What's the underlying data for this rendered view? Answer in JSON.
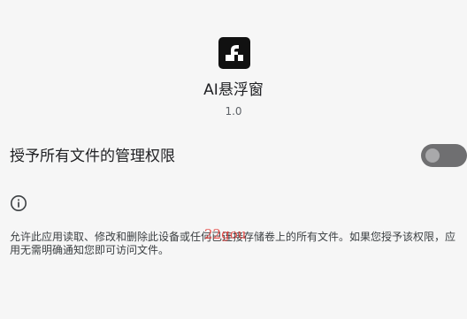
{
  "app": {
    "name": "AI悬浮窗",
    "version": "1.0",
    "icon": "app-logo-icon"
  },
  "permission": {
    "label": "授予所有文件的管理权限",
    "enabled": false,
    "colors": {
      "track_off": "#6f6f71",
      "thumb_off": "#a9a9ab"
    }
  },
  "info": {
    "icon": "info-icon",
    "description": "允许此应用读取、修改和删除此设备或任何已连接存储卷上的所有文件。如果您授予该权限，应用无需明确通知您即可访问文件。"
  },
  "watermark": {
    "text": "22gou"
  }
}
